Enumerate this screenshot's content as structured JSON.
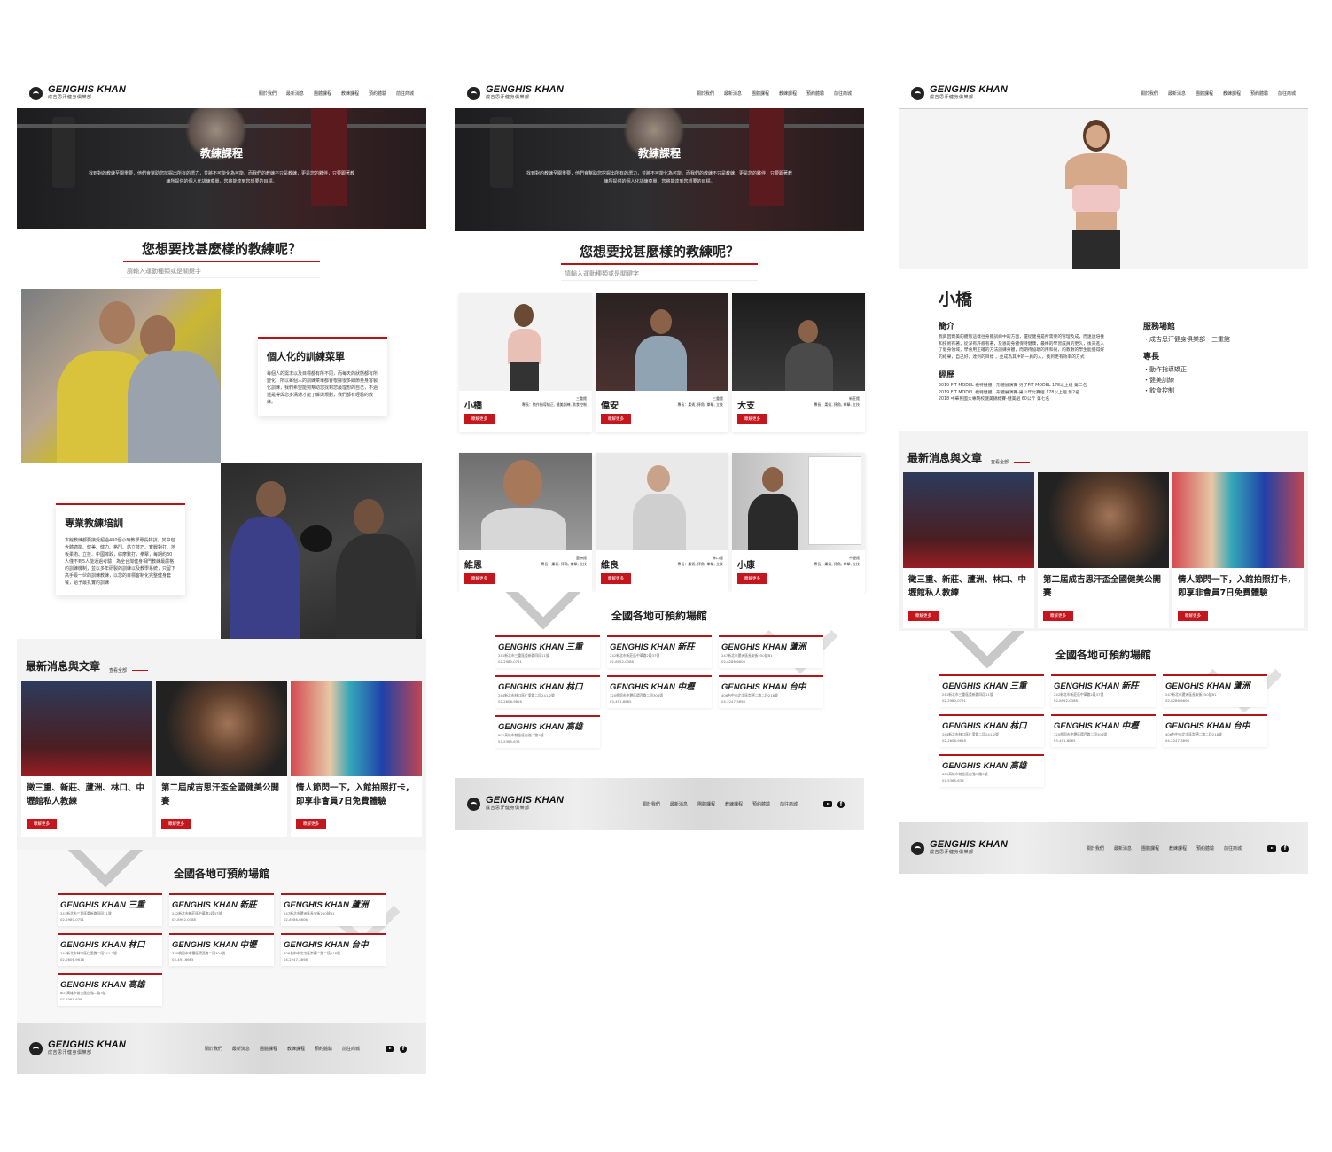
{
  "brand": {
    "name": "GENGHIS KHAN",
    "sub": "成吉思汗健身俱樂部"
  },
  "nav": [
    "關於我們",
    "最新消息",
    "團體課程",
    "教練課程",
    "預約體驗",
    "前往商城"
  ],
  "hero": {
    "title": "教練課程",
    "desc": "找到對的教練至關重要，他們會幫助您挖掘出所有的潛力，並將不可能化為可能。而我們的教練不只是教練，更是您的夥伴，只要跟著教練所提供的個人化訓練菜單，您將能達到您想要的目標。"
  },
  "search": {
    "title": "您想要找甚麼樣的教練呢？",
    "placeholder": "請輸入運動種類或是關鍵字"
  },
  "features": [
    {
      "title": "個人化的訓練菜單",
      "body": "每個人的需求以及目標都有所不同，而每天的狀態都有所變化，所以每個人的訓練菜單都會根據很多細節量身客製化訓練，我們希望能夠幫助您找到您最理想的自己，不過還是得與您多溝通才能了解與規劃，我們都有經驗的教練。"
    },
    {
      "title": "專業教練培訓",
      "body": "本館教練都要接受超過480個小時教學專長特訓，其中包含體適能、健美、健力、格鬥、站立技巧、實戰對打、地板柔術、立技、中國摔跤，綜摩數打，拳擊，每期約30人僅不到5人能通過考驗，為全台灣健身相門教練最嚴格的訓練機制，並以多年研製的訓練以及教學系統，只留下高手級一伙的訓練教練，以您的目標客制化完整健身套餐，給予最扎實的訓練"
    }
  ],
  "news": {
    "title": "最新消息與文章",
    "more": "查看全部",
    "items": [
      {
        "title": "徵三重、新莊、蘆洲、林口、中壢館私人教練",
        "btn": "瞭解更多"
      },
      {
        "title": "第二屆成吉思汗盃全國健美公開賽",
        "btn": "瞭解更多"
      },
      {
        "title": "情人節閃一下，入館拍照打卡，即享非會員7日免費體驗",
        "btn": "瞭解更多"
      }
    ]
  },
  "venues": {
    "title": "全國各地可預約場館",
    "items": [
      {
        "name": "GENGHIS KHAN 三重",
        "addr": "241新北市三重區重新路四段11號",
        "tel": "02-2980-0751"
      },
      {
        "name": "GENGHIS KHAN 新莊",
        "addr": "242新北市新莊區中華路2段37號",
        "tel": "02-8992-0388"
      },
      {
        "name": "GENGHIS KHAN 蘆洲",
        "addr": "247新北市蘆洲區長安街250號B1",
        "tel": "02-8286-6606"
      },
      {
        "name": "GENGHIS KHAN 林口",
        "addr": "244新北市林口區仁愛路二段241-2號",
        "tel": "02-2606-9616"
      },
      {
        "name": "GENGHIS KHAN 中壢",
        "addr": "320桃園市中壢區環西路二段304號",
        "tel": "03-491-6665"
      },
      {
        "name": "GENGHIS KHAN 台中",
        "addr": "406台中市北屯區崇德二路二段218號",
        "tel": "04-2247-3898"
      },
      {
        "name": "GENGHIS KHAN 高雄",
        "addr": "801高雄市前金區自強二路3號",
        "tel": "07-5365-638"
      }
    ]
  },
  "coaches": [
    {
      "name": "小橋",
      "loc": "三重館",
      "spec": "專長：動作指導矯正, 健美訓練, 飲食控制",
      "btn": "瞭解更多"
    },
    {
      "name": "偉安",
      "loc": "三重館",
      "spec": "專長：柔術, 摔角, 拳擊, 立技",
      "btn": "瞭解更多"
    },
    {
      "name": "大支",
      "loc": "新莊館",
      "spec": "專長：柔術, 摔角, 拳擊, 立技",
      "btn": "瞭解更多"
    },
    {
      "name": "維恩",
      "loc": "蘆洲館",
      "spec": "專長：柔術, 摔角, 拳擊, 立技",
      "btn": "瞭解更多"
    },
    {
      "name": "維良",
      "loc": "林口館",
      "spec": "專長：柔術, 摔角, 拳擊, 立技",
      "btn": "瞭解更多"
    },
    {
      "name": "小康",
      "loc": "中壢館",
      "spec": "專長：柔術, 摔角, 拳擊, 立技",
      "btn": "瞭解更多"
    }
  ],
  "profile": {
    "name": "小橋",
    "intro_h": "簡介",
    "intro": "我興因對美的體態這樣往身體訓練中的方面，還從健身是所需要的管理及成，而遠遠培養和技術有著，從深有許疲有著，及恩的身體保持健康，最棒的學習成員的更久，後來進入了健身領域，學會用正確的方法訓練身體，而期待協助的用和很，的教數的學生能獲得好的結果，自己好，達到的目標 ，並成為其中的一員的人，找到更有效率的方式",
    "exp_h": "經歷",
    "exp": [
      "2019 FIT MODEL 模特健體，形體展演賽-男子FIT MODEL 178以上組 第三名",
      "2019 FIT MODEL 模特健體，形體展演賽-男少年比賽組 178以上組 第2名",
      "2018 中華民國大專院校健美錦標賽-健美組 60公斤 第七名"
    ],
    "venue_h": "服務場館",
    "venue": [
      "成吉思汗健身俱樂部 - 三重館"
    ],
    "spec_h": "專長",
    "specs": [
      "動作指導矯正",
      "健美訓練",
      "飲食控制"
    ]
  },
  "colors": {
    "accent": "#b3151b",
    "button": "#c4161c"
  },
  "icons": [
    "youtube-icon",
    "facebook-icon",
    "logo-mark-icon"
  ]
}
